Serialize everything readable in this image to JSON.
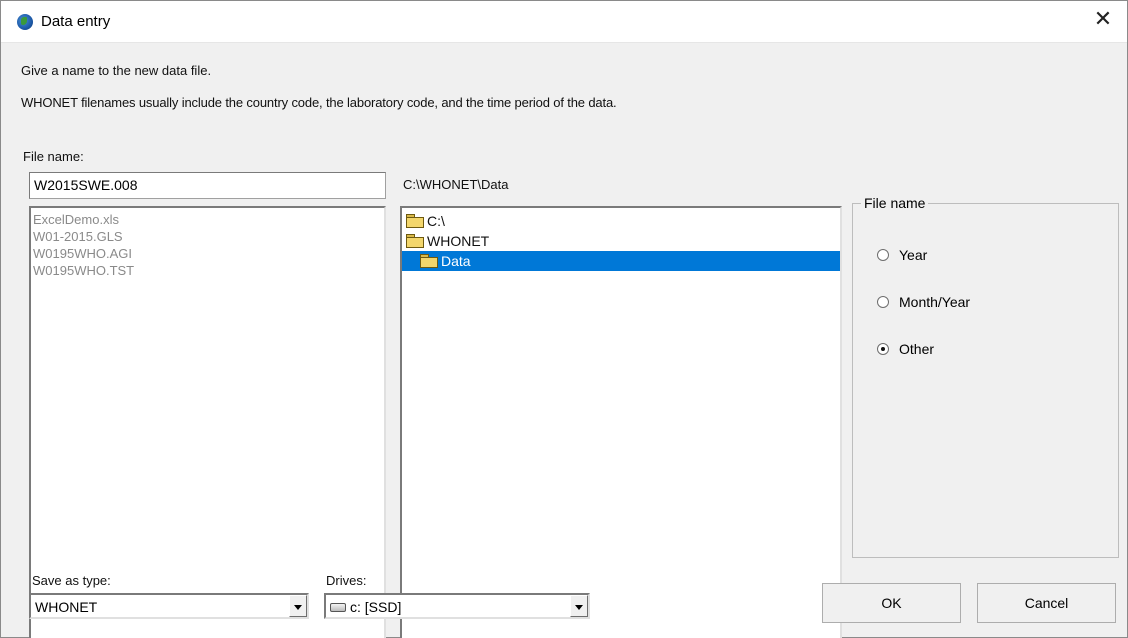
{
  "window": {
    "title": "Data entry",
    "close_glyph": "✕"
  },
  "instructions": {
    "line1": "Give a name to the new data file.",
    "line2": "WHONET filenames usually include the country code, the laboratory code, and the time period of the data."
  },
  "file_name": {
    "label": "File name:",
    "value": "W2015SWE.008"
  },
  "current_path": "C:\\WHONET\\Data",
  "files": [
    "ExcelDemo.xls",
    "W01-2015.GLS",
    "W0195WHO.AGI",
    "W0195WHO.TST"
  ],
  "directories": [
    {
      "label": "C:\\",
      "selected": false
    },
    {
      "label": "WHONET",
      "selected": false
    },
    {
      "label": "Data",
      "selected": true
    }
  ],
  "file_name_group": {
    "title": "File name",
    "options": [
      {
        "label": "Year",
        "selected": false
      },
      {
        "label": "Month/Year",
        "selected": false
      },
      {
        "label": "Other",
        "selected": true
      }
    ]
  },
  "save_as_type": {
    "label": "Save as type:",
    "value": "WHONET"
  },
  "drives": {
    "label": "Drives:",
    "value": "c: [SSD]"
  },
  "buttons": {
    "ok": "OK",
    "cancel": "Cancel"
  },
  "colors": {
    "selection": "#0078d7",
    "dialog_bg": "#f0f0f0"
  }
}
